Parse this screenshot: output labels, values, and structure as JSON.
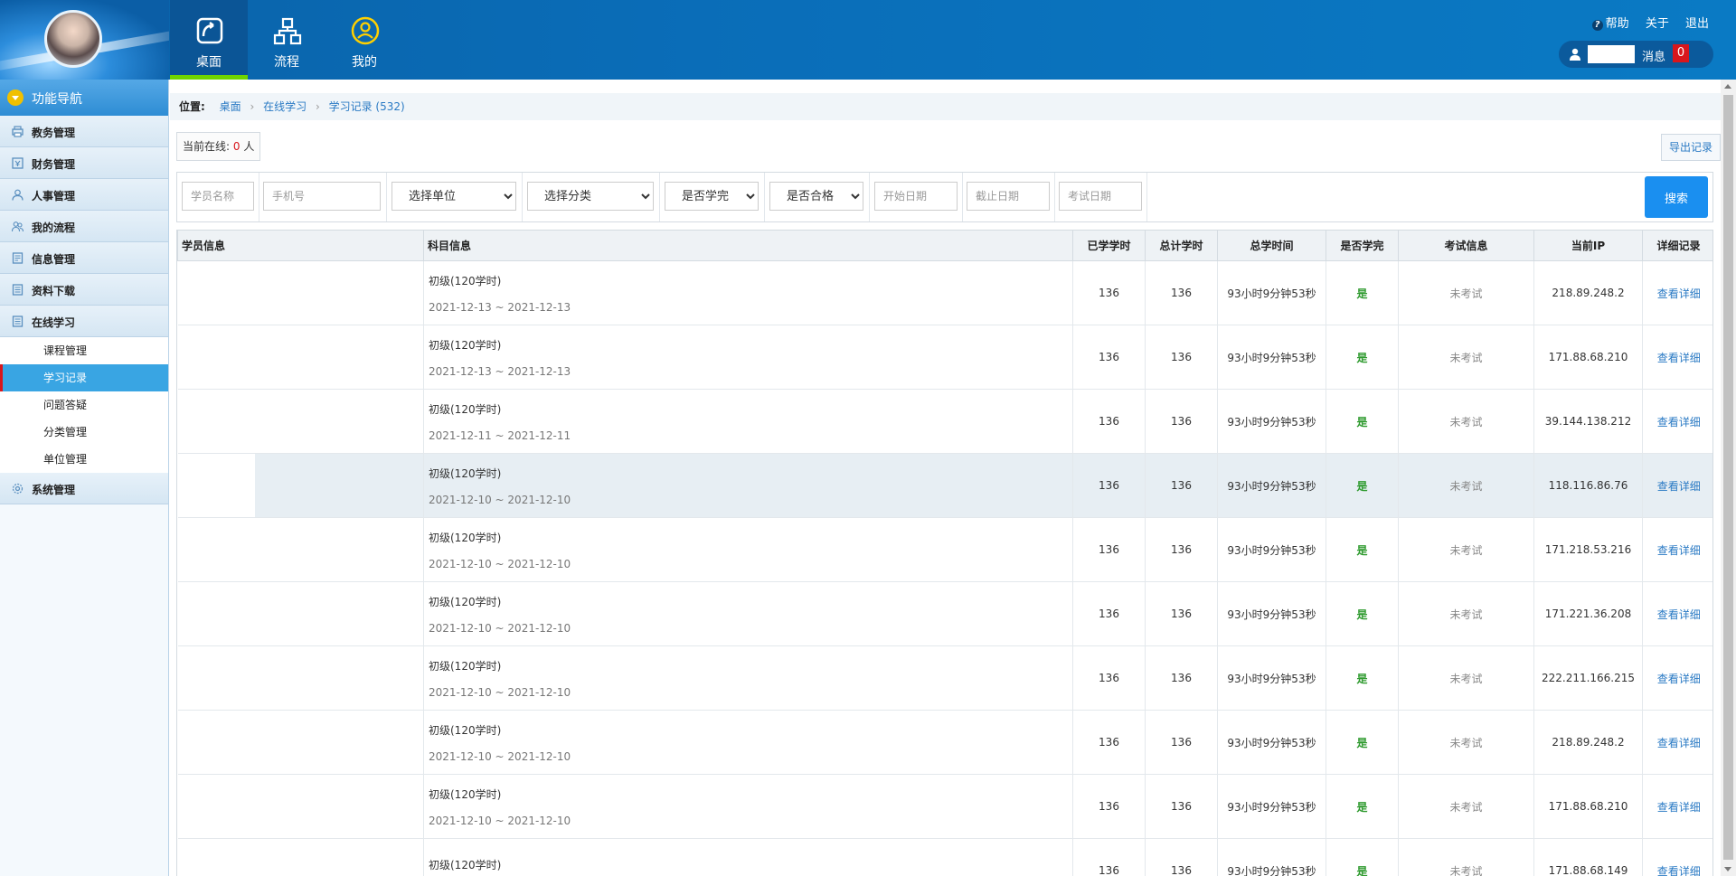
{
  "header": {
    "tabs": [
      {
        "label": "桌面",
        "icon": "desktop-icon",
        "active": true
      },
      {
        "label": "流程",
        "icon": "flow-icon",
        "active": false
      },
      {
        "label": "我的",
        "icon": "user-circle-icon",
        "active": false
      }
    ],
    "links": {
      "help": "帮助",
      "about": "关于",
      "logout": "退出"
    },
    "user": {
      "message_label": "消息",
      "message_count": "0"
    }
  },
  "sidebar": {
    "title": "功能导航",
    "menu": [
      {
        "label": "教务管理",
        "icon": "printer-icon"
      },
      {
        "label": "财务管理",
        "icon": "finance-icon"
      },
      {
        "label": "人事管理",
        "icon": "person-icon"
      },
      {
        "label": "我的流程",
        "icon": "people-icon"
      },
      {
        "label": "信息管理",
        "icon": "doc-icon"
      },
      {
        "label": "资料下载",
        "icon": "download-doc-icon"
      },
      {
        "label": "在线学习",
        "icon": "book-icon"
      }
    ],
    "sub_items": [
      "课程管理",
      "学习记录",
      "问题答疑",
      "分类管理",
      "单位管理"
    ],
    "last_menu": {
      "label": "系统管理",
      "icon": "gear-icon"
    }
  },
  "breadcrumb": {
    "label": "位置:",
    "items": [
      "桌面",
      "在线学习",
      "学习记录 (532)"
    ]
  },
  "online": {
    "label": "当前在线:",
    "count": "0",
    "unit": "人"
  },
  "export_label": "导出记录",
  "filters": {
    "student_name": "学员名称",
    "phone": "手机号",
    "unit": "选择单位",
    "category": "选择分类",
    "finished": "是否学完",
    "passed": "是否合格",
    "start_date": "开始日期",
    "end_date": "截止日期",
    "exam_date": "考试日期",
    "search": "搜索"
  },
  "table": {
    "headers": [
      "学员信息",
      "科目信息",
      "已学学时",
      "总计学时",
      "总学时间",
      "是否学完",
      "考试信息",
      "当前IP",
      "详细记录"
    ],
    "rows": [
      {
        "subject": "初级(120学时)",
        "dates": "2021-12-13 ~ 2021-12-13",
        "learned": "136",
        "total": "136",
        "time": "93小时9分钟53秒",
        "finished": "是",
        "exam": "未考试",
        "ip": "218.89.248.2",
        "detail": "查看详细"
      },
      {
        "subject": "初级(120学时)",
        "dates": "2021-12-13 ~ 2021-12-13",
        "learned": "136",
        "total": "136",
        "time": "93小时9分钟53秒",
        "finished": "是",
        "exam": "未考试",
        "ip": "171.88.68.210",
        "detail": "查看详细"
      },
      {
        "subject": "初级(120学时)",
        "dates": "2021-12-11 ~ 2021-12-11",
        "learned": "136",
        "total": "136",
        "time": "93小时9分钟53秒",
        "finished": "是",
        "exam": "未考试",
        "ip": "39.144.138.212",
        "detail": "查看详细"
      },
      {
        "subject": "初级(120学时)",
        "dates": "2021-12-10 ~ 2021-12-10",
        "learned": "136",
        "total": "136",
        "time": "93小时9分钟53秒",
        "finished": "是",
        "exam": "未考试",
        "ip": "118.116.86.76",
        "detail": "查看详细"
      },
      {
        "subject": "初级(120学时)",
        "dates": "2021-12-10 ~ 2021-12-10",
        "learned": "136",
        "total": "136",
        "time": "93小时9分钟53秒",
        "finished": "是",
        "exam": "未考试",
        "ip": "171.218.53.216",
        "detail": "查看详细"
      },
      {
        "subject": "初级(120学时)",
        "dates": "2021-12-10 ~ 2021-12-10",
        "learned": "136",
        "total": "136",
        "time": "93小时9分钟53秒",
        "finished": "是",
        "exam": "未考试",
        "ip": "171.221.36.208",
        "detail": "查看详细"
      },
      {
        "subject": "初级(120学时)",
        "dates": "2021-12-10 ~ 2021-12-10",
        "learned": "136",
        "total": "136",
        "time": "93小时9分钟53秒",
        "finished": "是",
        "exam": "未考试",
        "ip": "222.211.166.215",
        "detail": "查看详细"
      },
      {
        "subject": "初级(120学时)",
        "dates": "2021-12-10 ~ 2021-12-10",
        "learned": "136",
        "total": "136",
        "time": "93小时9分钟53秒",
        "finished": "是",
        "exam": "未考试",
        "ip": "218.89.248.2",
        "detail": "查看详细"
      },
      {
        "subject": "初级(120学时)",
        "dates": "2021-12-10 ~ 2021-12-10",
        "learned": "136",
        "total": "136",
        "time": "93小时9分钟53秒",
        "finished": "是",
        "exam": "未考试",
        "ip": "171.88.68.210",
        "detail": "查看详细"
      },
      {
        "subject": "初级(120学时)",
        "dates": "",
        "learned": "136",
        "total": "136",
        "time": "93小时9分钟53秒",
        "finished": "是",
        "exam": "未考试",
        "ip": "171.88.68.149",
        "detail": "查看详细"
      }
    ]
  },
  "colors": {
    "accent": "#1a8ff0",
    "header_bg": "#0a6db8",
    "active_tab_bar": "#6fd400",
    "badge_red": "#d8161c",
    "done_green": "#2e9a2e"
  }
}
